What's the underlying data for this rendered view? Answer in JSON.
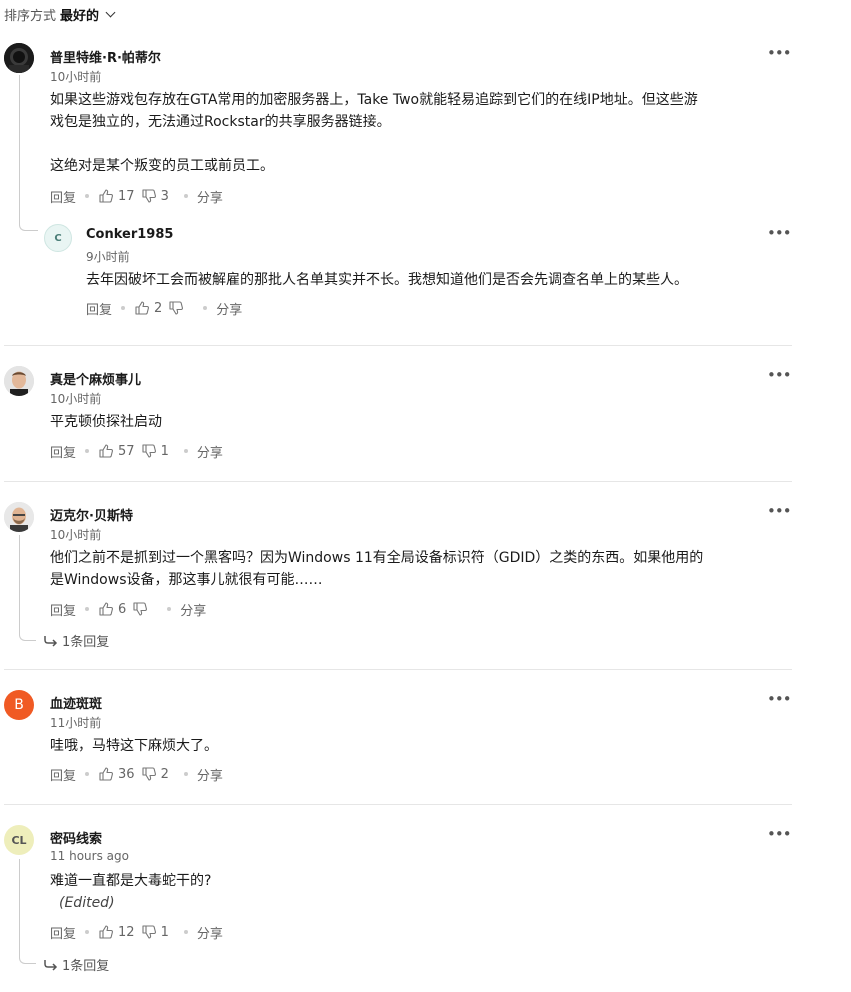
{
  "sort": {
    "label": "排序方式",
    "value": "最好的"
  },
  "actions": {
    "reply": "回复",
    "share": "分享"
  },
  "comments": [
    {
      "author": "普里特维·R·帕蒂尔",
      "time": "10小时前",
      "body_lines": [
        "如果这些游戏包存放在GTA常用的加密服务器上，Take Two就能轻易追踪到它们的在线IP地址。但这些游",
        "戏包是独立的，无法通过Rockstar的共享服务器链接。",
        "",
        "这绝对是某个叛变的员工或前员工。"
      ],
      "likes": "17",
      "dislikes": "3",
      "reply": {
        "author": "Conker1985",
        "avatar_text": "C",
        "time": "9小时前",
        "body": "去年因破坏工会而被解雇的那批人名单其实并不长。我想知道他们是否会先调查名单上的某些人。",
        "likes": "2",
        "dislikes": ""
      }
    },
    {
      "author": "真是个麻烦事儿",
      "time": "10小时前",
      "body": "平克顿侦探社启动",
      "likes": "57",
      "dislikes": "1"
    },
    {
      "author": "迈克尔·贝斯特",
      "time": "10小时前",
      "body_lines": [
        "他们之前不是抓到过一个黑客吗？因为Windows 11有全局设备标识符（GDID）之类的东西。如果他用的",
        "是Windows设备，那这事儿就很有可能……"
      ],
      "likes": "6",
      "dislikes": "",
      "replies_label": "1条回复"
    },
    {
      "author": "血迹斑斑",
      "avatar_text": "B",
      "avatar_color": "#f05a24",
      "time": "11小时前",
      "body": "哇哦，马特这下麻烦大了。",
      "likes": "36",
      "dislikes": "2"
    },
    {
      "author": "密码线索",
      "avatar_text": "CL",
      "avatar_color": "#eeeebb",
      "time": "11 hours ago",
      "body": "难道一直都是大毒蛇干的?",
      "edited": "(Edited)",
      "likes": "12",
      "dislikes": "1",
      "replies_label": "1条回复"
    }
  ]
}
